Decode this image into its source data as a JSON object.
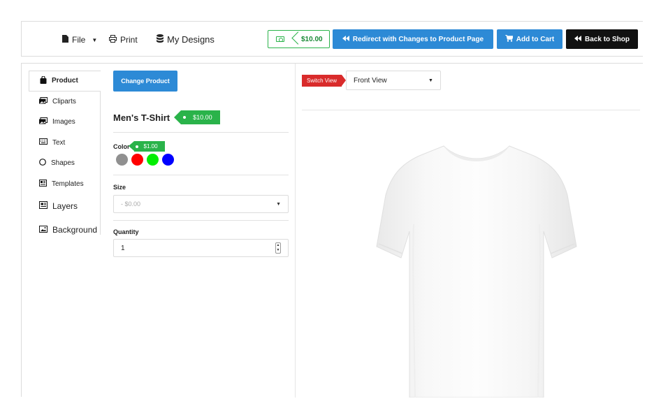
{
  "toolbar": {
    "file_label": "File",
    "print_label": "Print",
    "designs_label": "My Designs",
    "price": "$10.00",
    "redirect_label": "Redirect with Changes to Product Page",
    "cart_label": "Add to Cart",
    "back_label": "Back to Shop"
  },
  "sidebar": {
    "items": [
      {
        "label": "Product",
        "icon": "bag-icon"
      },
      {
        "label": "Cliparts",
        "icon": "image-icon"
      },
      {
        "label": "Images",
        "icon": "image-icon"
      },
      {
        "label": "Text",
        "icon": "keyboard-icon"
      },
      {
        "label": "Shapes",
        "icon": "circle-icon"
      },
      {
        "label": "Templates",
        "icon": "template-icon"
      },
      {
        "label": "Layers",
        "icon": "layers-icon"
      },
      {
        "label": "Background",
        "icon": "picture-icon"
      }
    ]
  },
  "product": {
    "change_label": "Change Product",
    "title": "Men's T-Shirt",
    "price": "$10.00",
    "color_label": "Color",
    "color_price": "$1.00",
    "colors": [
      "#909090",
      "#ff0000",
      "#00ee00",
      "#0000ff"
    ],
    "size_label": "Size",
    "size_placeholder": "- $0.00",
    "quantity_label": "Quantity",
    "quantity_value": "1"
  },
  "preview": {
    "switch_label": "Switch View",
    "view_value": "Front View"
  },
  "colors": {
    "primary": "#2d8ad6",
    "success": "#2ab34a",
    "danger": "#d92b2b",
    "dark": "#111111"
  }
}
